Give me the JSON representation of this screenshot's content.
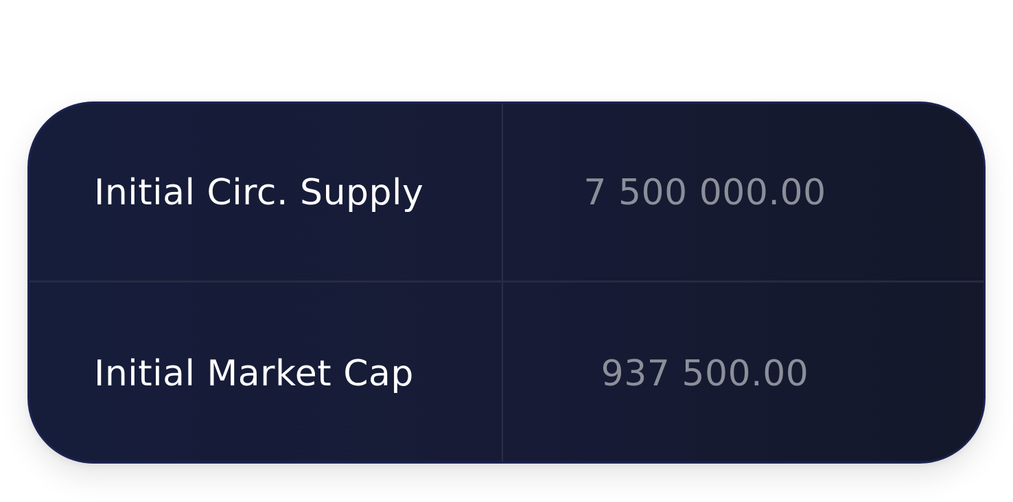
{
  "rows": [
    {
      "label": "Initial Circ. Supply",
      "value": "7 500 000.00"
    },
    {
      "label": "Initial Market Cap",
      "value": "937 500.00"
    }
  ],
  "colors": {
    "card_background": "#171b36",
    "card_border": "#1b2350",
    "label_text": "#ffffff",
    "value_text": "#8c8f9a",
    "divider": "#2a2f45"
  }
}
